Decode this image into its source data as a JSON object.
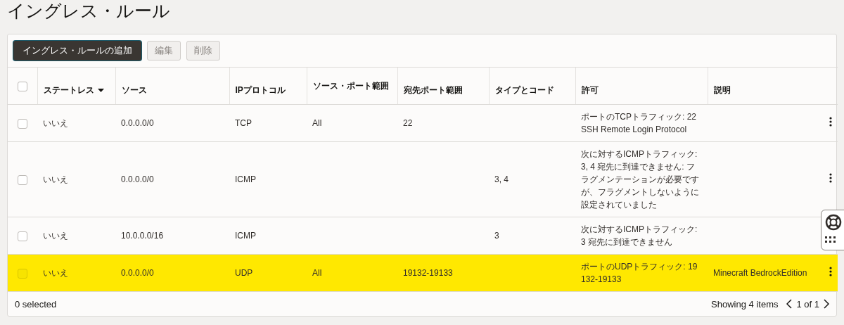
{
  "page_title": "イングレス・ルール",
  "toolbar": [
    {
      "label": "イングレス・ルールの追加",
      "kind": "primary",
      "disabled": false
    },
    {
      "label": "編集",
      "kind": "secondary",
      "disabled": true
    },
    {
      "label": "削除",
      "kind": "secondary",
      "disabled": true
    }
  ],
  "table": {
    "select_all": {
      "checked": false
    },
    "columns": [
      {
        "label": "ステートレス",
        "sorted": true
      },
      {
        "label": "ソース",
        "sorted": false
      },
      {
        "label": "IPプロトコル",
        "sorted": false
      },
      {
        "label": "ソース・ポート範囲",
        "sorted": false
      },
      {
        "label": "宛先ポート範囲",
        "sorted": false
      },
      {
        "label": "タイプとコード",
        "sorted": false
      },
      {
        "label": "許可",
        "sorted": false
      },
      {
        "label": "説明",
        "sorted": false
      }
    ],
    "rows": [
      {
        "selected": false,
        "highlighted": false,
        "cells": [
          "いいえ",
          "0.0.0.0/0",
          "TCP",
          "All",
          "22",
          null,
          "ポートのTCPトラフィック: 22 SSH Remote Login Protocol",
          null
        ]
      },
      {
        "selected": false,
        "highlighted": false,
        "cells": [
          "いいえ",
          "0.0.0.0/0",
          "ICMP",
          null,
          null,
          "3, 4",
          "次に対するICMPトラフィック: 3, 4 宛先に到達できません: フラグメンテーションが必要ですが、フラグメントしないように設定されていました",
          null
        ]
      },
      {
        "selected": false,
        "highlighted": false,
        "cells": [
          "いいえ",
          "10.0.0.0/16",
          "ICMP",
          null,
          null,
          "3",
          "次に対するICMPトラフィック: 3 宛先に到達できません",
          null
        ]
      },
      {
        "selected": false,
        "highlighted": true,
        "cells": [
          "いいえ",
          "0.0.0.0/0",
          "UDP",
          "All",
          "19132-19133",
          null,
          "ポートのUDPトラフィック: 19132-19133",
          "Minecraft BedrockEdition"
        ]
      }
    ]
  },
  "footer": {
    "selected_count": "0 selected",
    "showing": "Showing 4 items",
    "page": "1 of 1"
  }
}
